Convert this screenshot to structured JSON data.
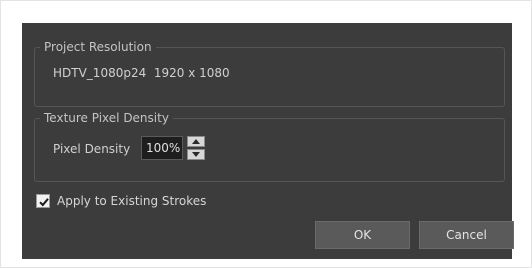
{
  "project_resolution": {
    "title": "Project Resolution",
    "value": "HDTV_1080p24  1920 x 1080"
  },
  "texture_pixel_density": {
    "title": "Texture Pixel Density",
    "label": "Pixel Density",
    "value": "100%"
  },
  "apply_existing": {
    "label": "Apply to Existing Strokes",
    "checked": true
  },
  "buttons": {
    "ok": "OK",
    "cancel": "Cancel"
  },
  "colors": {
    "dialog_bg": "#3c3c3c",
    "button_bg": "#5a5a5a",
    "input_bg": "#1e1e1e"
  }
}
